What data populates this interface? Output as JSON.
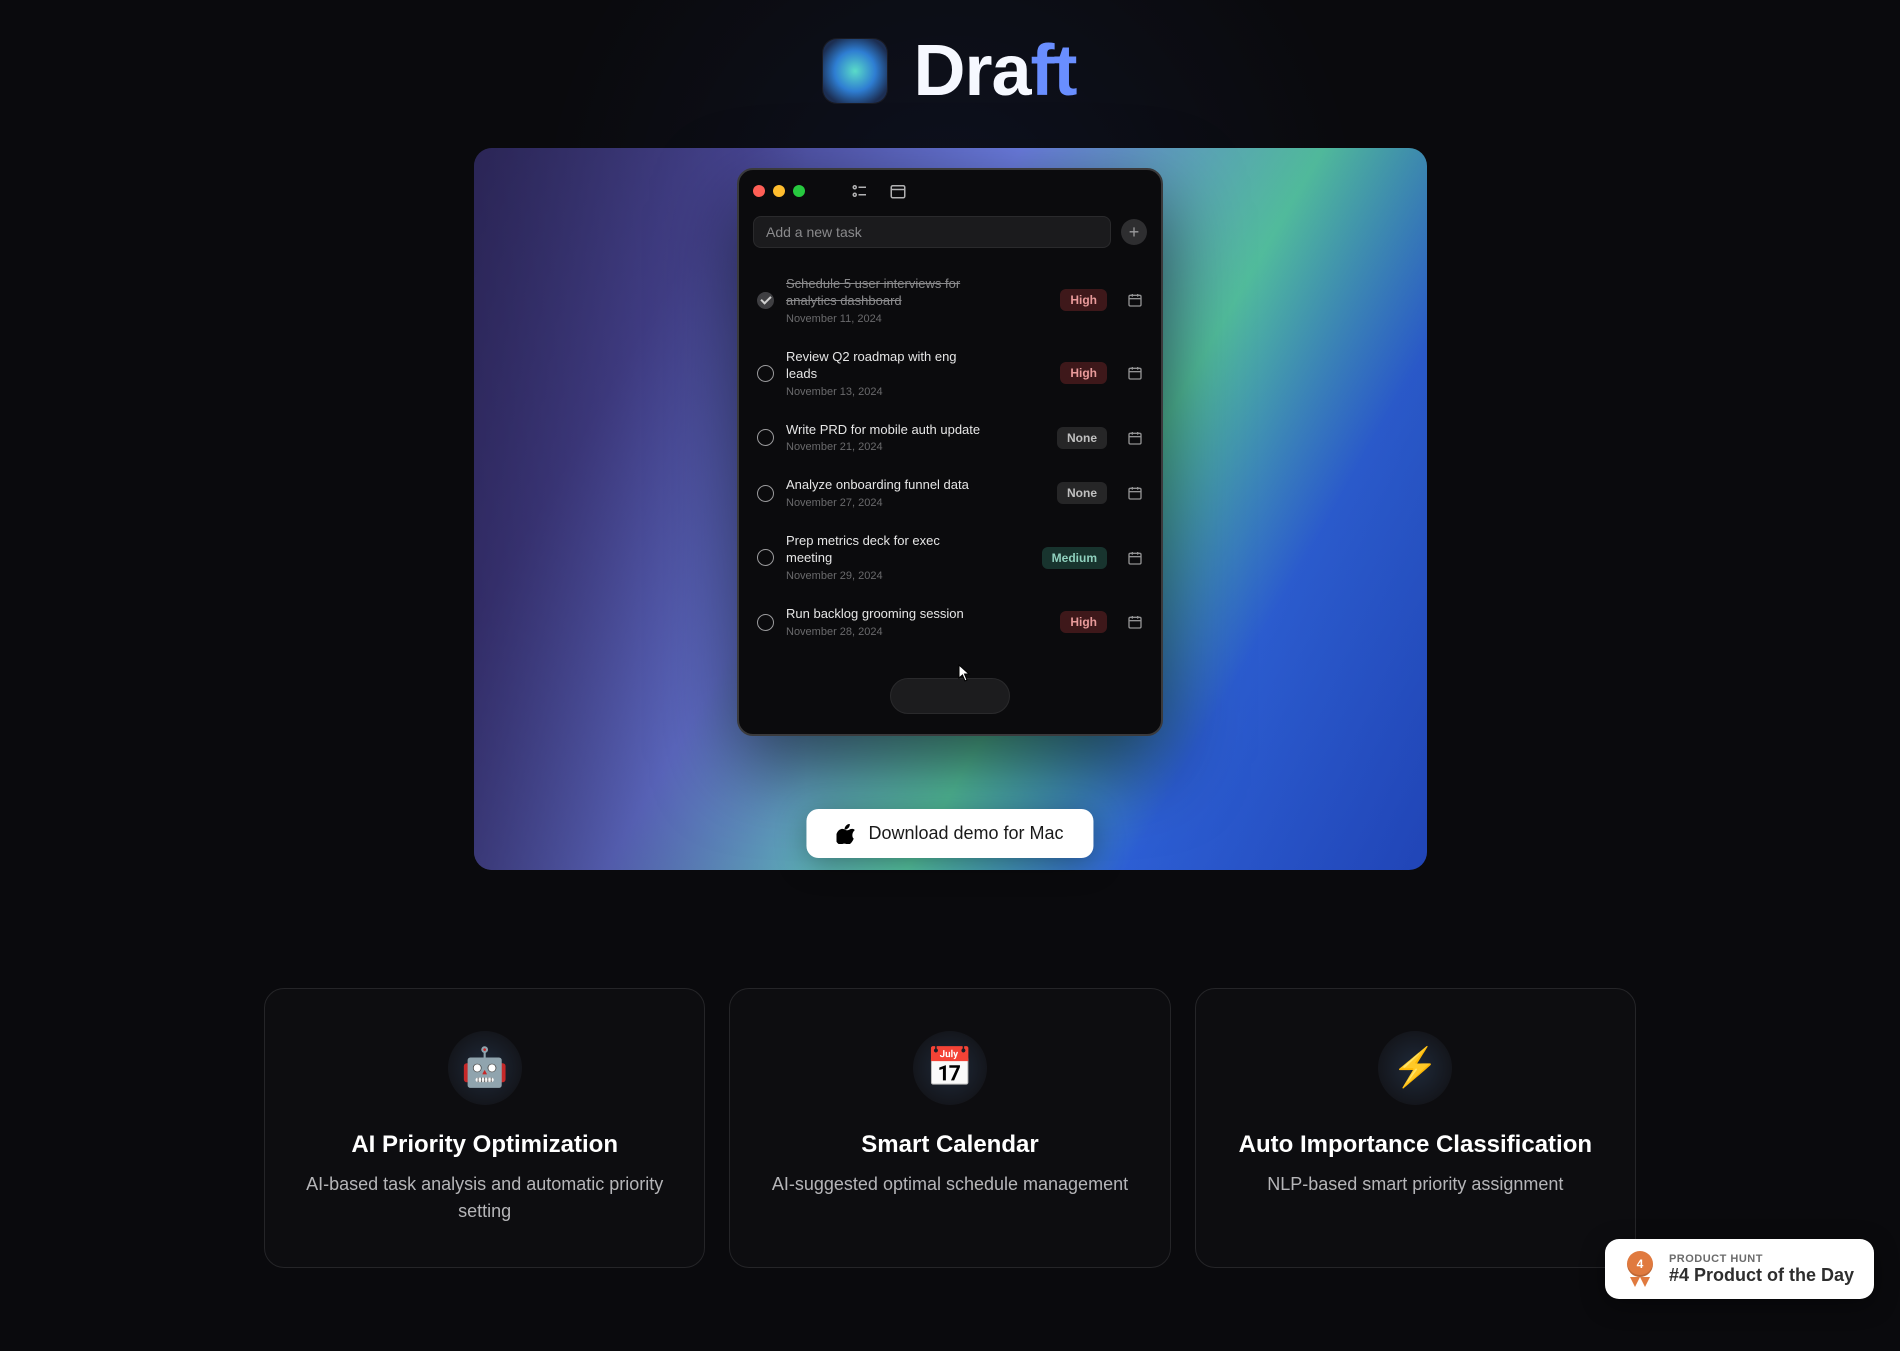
{
  "hero": {
    "title_left": "Dra",
    "title_right": "ft"
  },
  "app": {
    "input_placeholder": "Add a new task",
    "tasks": [
      {
        "title": "Schedule 5 user interviews for analytics dashboard",
        "date": "November 11, 2024",
        "priority": "High",
        "done": true
      },
      {
        "title": "Review Q2 roadmap with eng leads",
        "date": "November 13, 2024",
        "priority": "High",
        "done": false
      },
      {
        "title": "Write PRD for mobile auth update",
        "date": "November 21, 2024",
        "priority": "None",
        "done": false
      },
      {
        "title": "Analyze onboarding funnel data",
        "date": "November 27, 2024",
        "priority": "None",
        "done": false
      },
      {
        "title": "Prep metrics deck for exec meeting",
        "date": "November 29, 2024",
        "priority": "Medium",
        "done": false
      },
      {
        "title": "Run backlog grooming session",
        "date": "November 28, 2024",
        "priority": "High",
        "done": false
      }
    ]
  },
  "download": {
    "label": "Download demo for Mac"
  },
  "features": [
    {
      "icon": "🤖",
      "title": "AI Priority Optimization",
      "desc": "AI-based task analysis and automatic priority setting"
    },
    {
      "icon": "📅",
      "title": "Smart Calendar",
      "desc": "AI-suggested optimal schedule management"
    },
    {
      "icon": "⚡",
      "title": "Auto Importance Classification",
      "desc": "NLP-based smart priority assignment"
    }
  ],
  "product_hunt": {
    "label": "PRODUCT HUNT",
    "main": "#4 Product of the Day",
    "rank": "4"
  }
}
